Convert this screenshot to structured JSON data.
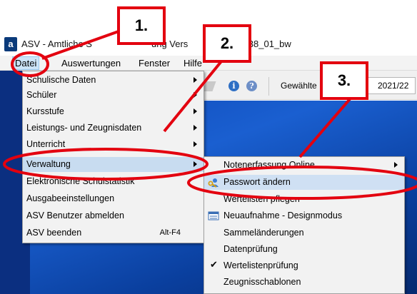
{
  "window": {
    "app_icon_letter": "a",
    "title_part_a": "ASV - Amtliche S",
    "title_part_b": "ung Vers",
    "title_part_c": "_038_01_bw"
  },
  "menubar": {
    "items": [
      {
        "label": "Datei",
        "active": true
      },
      {
        "label": "Auswertungen",
        "active": false
      },
      {
        "label": "Fenster",
        "active": false
      },
      {
        "label": "Hilfe",
        "active": false
      }
    ]
  },
  "toolbar": {
    "info_icon": "info-icon",
    "help_icon": "help-icon",
    "selected_label": "Gewählte",
    "selected_value": "2021/22"
  },
  "file_menu": {
    "items": [
      {
        "label": "Schulische Daten",
        "submenu": true
      },
      {
        "label": "Schüler",
        "submenu": true
      },
      {
        "label": "Kursstufe",
        "submenu": true
      },
      {
        "label": "Leistungs- und Zeugnisdaten",
        "submenu": true
      },
      {
        "label": "Unterricht",
        "submenu": true
      },
      {
        "label": "Verwaltung",
        "submenu": true,
        "highlighted": true
      },
      {
        "label": "Elektronische Schulstatistik",
        "submenu": false
      },
      {
        "label": "Ausgabeeinstellungen",
        "submenu": false
      },
      {
        "label": "ASV Benutzer abmelden",
        "submenu": false
      },
      {
        "label": "ASV beenden",
        "submenu": false,
        "shortcut": "Alt-F4"
      }
    ]
  },
  "verwaltung_menu": {
    "items": [
      {
        "label": "Notenerfassung Online",
        "submenu": true
      },
      {
        "label": "Passwort ändern",
        "highlighted": true,
        "icon": "key-person-icon"
      },
      {
        "label": "Wertelisten pflegen"
      },
      {
        "label": "Neuaufnahme - Designmodus",
        "icon": "form-icon"
      },
      {
        "label": "Sammeländerungen"
      },
      {
        "label": "Datenprüfung"
      },
      {
        "label": "Wertelistenprüfung",
        "checked": true
      },
      {
        "label": "Zeugnisschablonen"
      }
    ]
  },
  "annotations": {
    "step1": "1.",
    "step2": "2.",
    "step3": "3.",
    "color": "#e3000f"
  }
}
